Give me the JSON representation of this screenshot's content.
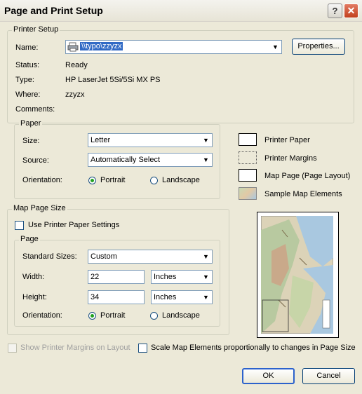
{
  "window": {
    "title": "Page and Print Setup",
    "help_label": "?",
    "close_label": "✕"
  },
  "printer_setup": {
    "group_label": "Printer Setup",
    "name_label": "Name:",
    "name_value": "\\\\typo\\zzyzx",
    "properties_label": "Properties...",
    "status_label": "Status:",
    "status_value": "Ready",
    "type_label": "Type:",
    "type_value": "HP LaserJet 5Si/5Si MX PS",
    "where_label": "Where:",
    "where_value": "zzyzx",
    "comments_label": "Comments:"
  },
  "paper": {
    "group_label": "Paper",
    "size_label": "Size:",
    "size_value": "Letter",
    "source_label": "Source:",
    "source_value": "Automatically Select",
    "orientation_label": "Orientation:",
    "portrait_label": "Portrait",
    "landscape_label": "Landscape",
    "selected": "portrait"
  },
  "legend": {
    "printer_paper": "Printer Paper",
    "printer_margins": "Printer Margins",
    "map_page": "Map Page (Page Layout)",
    "sample_elements": "Sample Map Elements"
  },
  "map_page_size": {
    "group_label": "Map Page Size",
    "use_printer_label": "Use Printer Paper Settings",
    "use_printer_checked": false,
    "page_group_label": "Page",
    "standard_sizes_label": "Standard Sizes:",
    "standard_sizes_value": "Custom",
    "width_label": "Width:",
    "width_value": "22",
    "width_unit": "Inches",
    "height_label": "Height:",
    "height_value": "34",
    "height_unit": "Inches",
    "orientation_label": "Orientation:",
    "portrait_label": "Portrait",
    "landscape_label": "Landscape",
    "selected": "portrait"
  },
  "options": {
    "show_margins_label": "Show Printer Margins on Layout",
    "scale_elements_label": "Scale Map Elements proportionally to changes in Page Size"
  },
  "buttons": {
    "ok_label": "OK",
    "cancel_label": "Cancel"
  },
  "colors": {
    "dialog_bg": "#ECE9D8",
    "field_border": "#7f9db9",
    "default_button": "#2c62cc"
  }
}
